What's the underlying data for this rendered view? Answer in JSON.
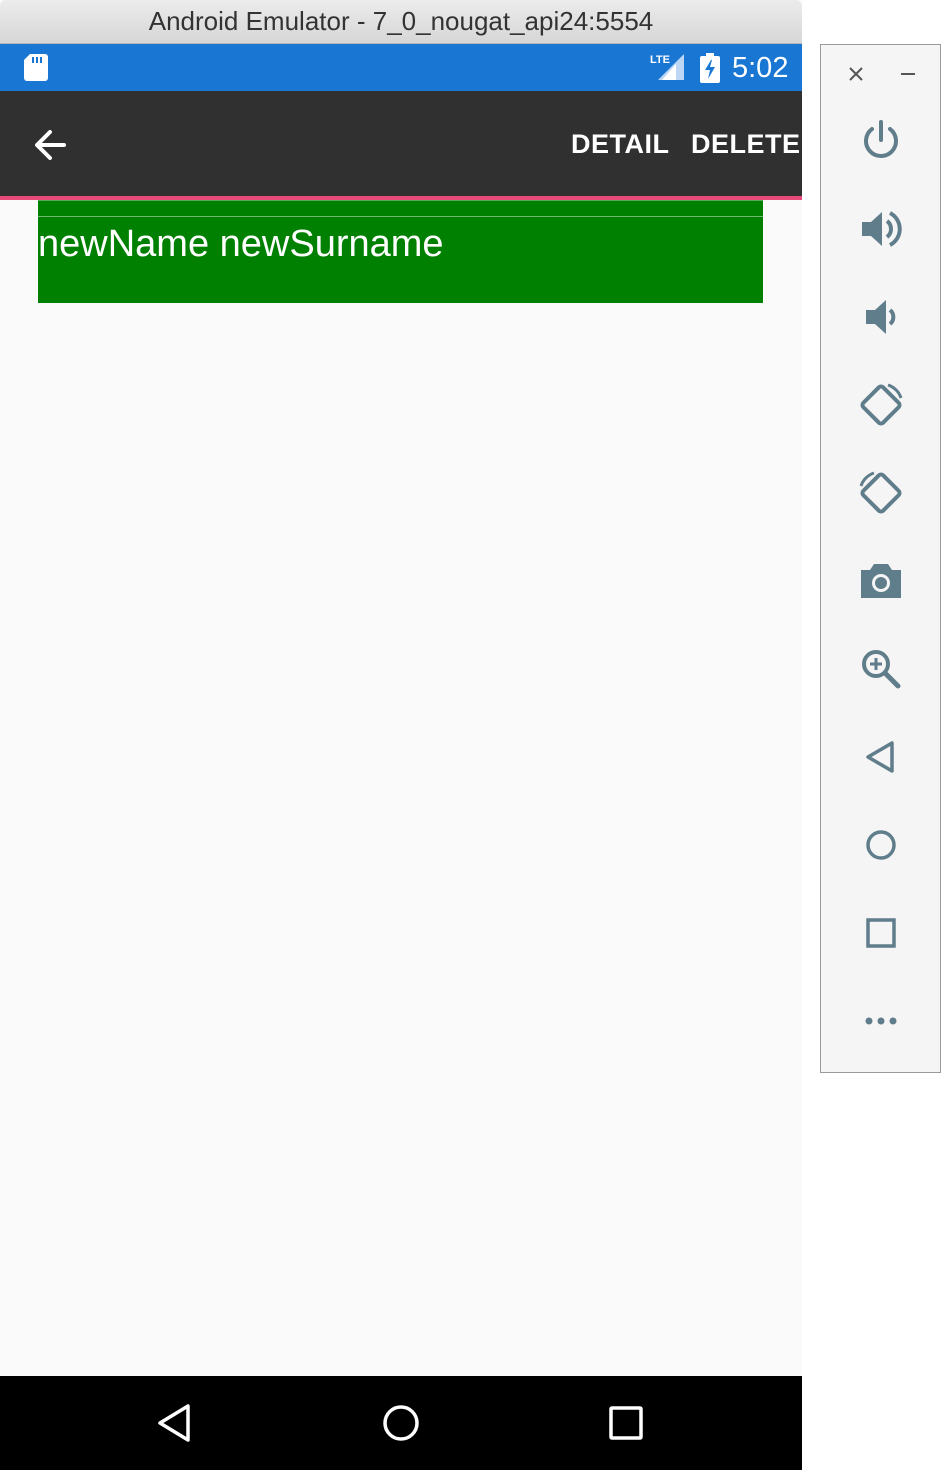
{
  "window": {
    "title": "Android Emulator - 7_0_nougat_api24:5554"
  },
  "status_bar": {
    "time": "5:02",
    "network": "LTE",
    "color": "#1976d2"
  },
  "app_bar": {
    "detail_label": "DETAIL",
    "delete_label": "DELETE",
    "background": "#303030",
    "accent": "#e84b7a"
  },
  "list": {
    "items": [
      {
        "label": "newName newSurname",
        "background": "#008000"
      }
    ]
  },
  "nav_bar": {
    "buttons": [
      "back-icon",
      "home-icon",
      "recents-icon"
    ]
  },
  "side_toolbar": {
    "buttons": [
      "power-icon",
      "volume-up-icon",
      "volume-down-icon",
      "rotate-left-icon",
      "rotate-right-icon",
      "camera-icon",
      "zoom-icon",
      "back-icon",
      "home-icon",
      "overview-icon",
      "more-icon"
    ]
  }
}
